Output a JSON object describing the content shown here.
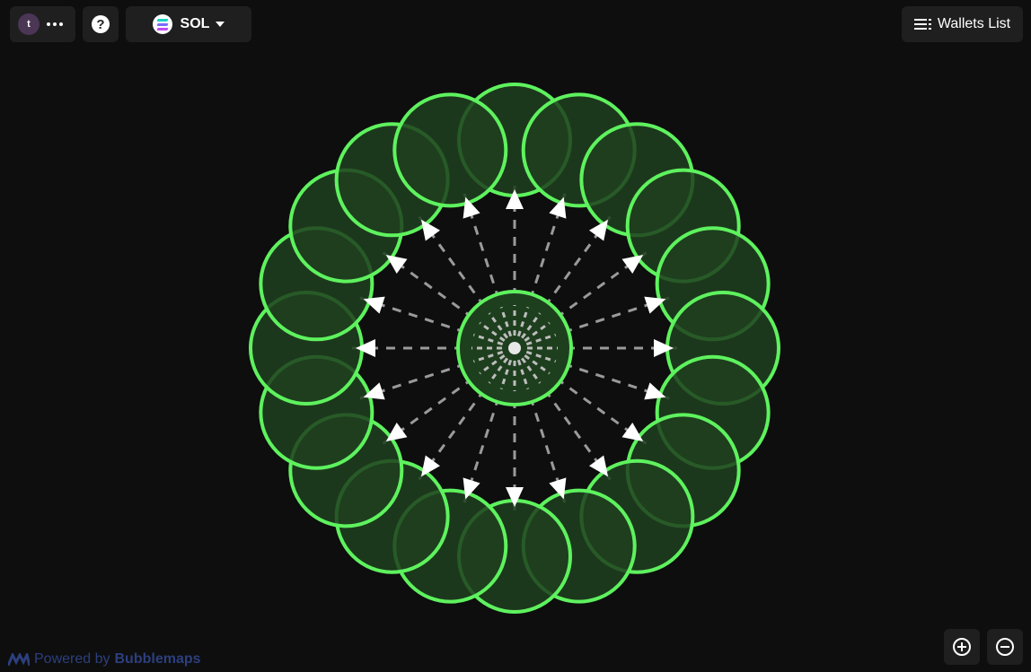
{
  "header": {
    "account": {
      "avatar_letter": "t",
      "menu_icon": "more-dots-icon"
    },
    "help": {
      "label": "?",
      "icon": "help-icon"
    },
    "chain": {
      "label": "SOL",
      "icon": "solana-logo-icon",
      "dropdown_icon": "caret-down-icon"
    },
    "wallets_list": {
      "label": "Wallets List",
      "icon": "list-icon"
    }
  },
  "graph": {
    "center_node": "center-wallet",
    "node_count_outer": 20,
    "colors": {
      "node_stroke": "#5ef25e",
      "node_fill": "#1e3f1e",
      "link": "#bdbdbd",
      "arrow": "#ffffff",
      "background": "#0e0e0e"
    }
  },
  "footer": {
    "powered_prefix": "Powered by",
    "brand": "Bubblemaps"
  },
  "zoom": {
    "in_icon": "zoom-in-icon",
    "out_icon": "zoom-out-icon"
  }
}
